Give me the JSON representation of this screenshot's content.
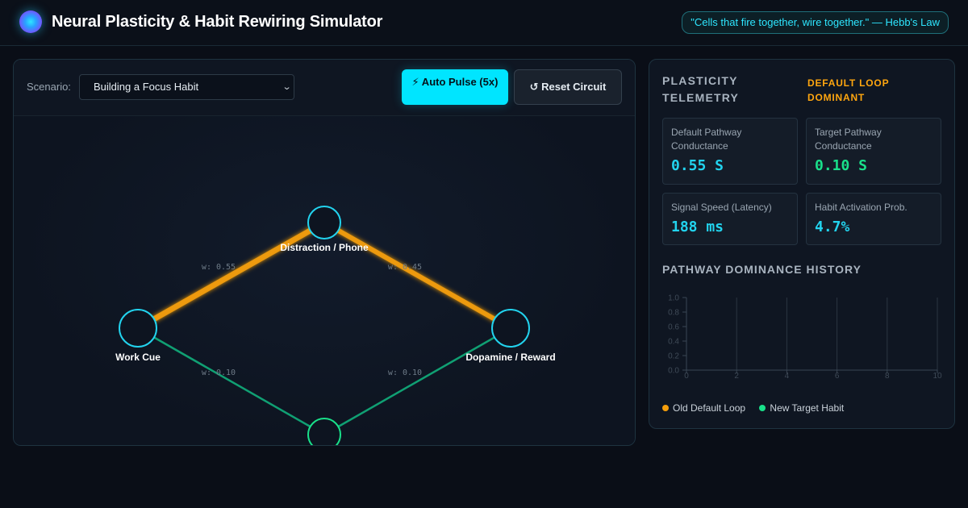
{
  "header": {
    "title": "Neural Plasticity & Habit Rewiring Simulator",
    "quote": "\"Cells that fire together, wire together.\" — Hebb's Law"
  },
  "toolbar": {
    "scenario_label": "Scenario:",
    "scenario_value": "Building a Focus Habit",
    "auto_pulse_label": "⚡ Auto Pulse (5x)",
    "reset_label": "↺ Reset Circuit"
  },
  "circuit": {
    "nodes": {
      "cue": "Work Cue",
      "distraction": "Distraction / Phone",
      "reward": "Dopamine / Reward",
      "target": ""
    },
    "weights": {
      "cue_to_distraction": "w: 0.55",
      "distraction_to_reward": "w: 0.45",
      "cue_to_target": "w: 0.10",
      "target_to_reward": "w: 0.10"
    }
  },
  "telemetry": {
    "title": "PLASTICITY TELEMETRY",
    "status": "DEFAULT LOOP DOMINANT",
    "metrics": [
      {
        "label": "Default Pathway Conductance",
        "value": "0.55 S"
      },
      {
        "label": "Target Pathway Conductance",
        "value": "0.10 S"
      },
      {
        "label": "Signal Speed (Latency)",
        "value": "188 ms"
      },
      {
        "label": "Habit Activation Prob.",
        "value": "4.7%"
      }
    ],
    "history_title": "PATHWAY DOMINANCE HISTORY",
    "legend": {
      "old": "Old Default Loop",
      "new": "New Target Habit"
    }
  },
  "colors": {
    "accent": "#00e5ff",
    "default_path": "#f59e0b",
    "target_path": "#10b981",
    "status": "#ffa60f",
    "target_value": "#19e08a"
  },
  "chart_data": {
    "type": "line",
    "title": "PATHWAY DOMINANCE HISTORY",
    "x_ticks": [
      0,
      2,
      4,
      6,
      8,
      10
    ],
    "y_ticks": [
      0.0,
      0.2,
      0.4,
      0.6,
      0.8,
      1.0
    ],
    "y_tick_labels": [
      "0.0",
      "0.2",
      "0.4",
      "0.6",
      "0.8",
      "1.0"
    ],
    "xlim": [
      0,
      10
    ],
    "ylim": [
      0,
      1
    ],
    "grid": "vertical",
    "legend_position": "bottom-left",
    "series": [
      {
        "name": "Old Default Loop",
        "color": "#f59e0b",
        "values": []
      },
      {
        "name": "New Target Habit",
        "color": "#10e07a",
        "values": []
      }
    ]
  }
}
